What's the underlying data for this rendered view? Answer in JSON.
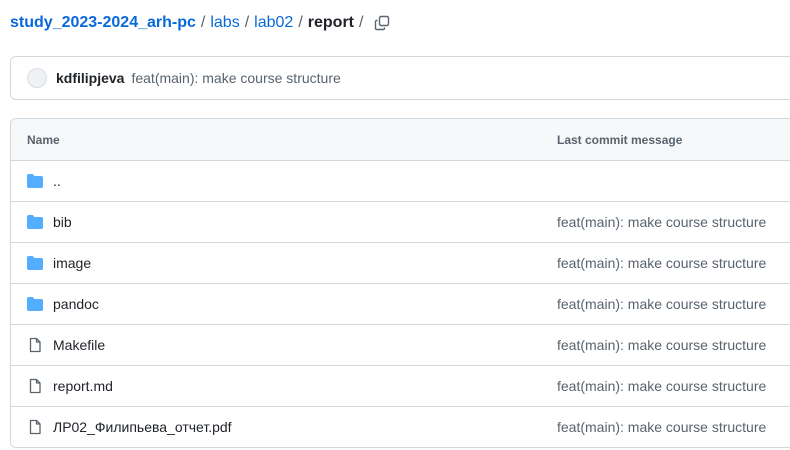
{
  "breadcrumb": {
    "repo": "study_2023-2024_arh-pc",
    "sep": "/",
    "dir1": "labs",
    "dir2": "lab02",
    "current": "report"
  },
  "commit": {
    "author": "kdfilipjeva",
    "message": "feat(main): make course structure"
  },
  "table": {
    "headers": {
      "name": "Name",
      "last_commit": "Last commit message"
    },
    "rows": [
      {
        "type": "folder",
        "name": "..",
        "message": ""
      },
      {
        "type": "folder",
        "name": "bib",
        "message": "feat(main): make course structure"
      },
      {
        "type": "folder",
        "name": "image",
        "message": "feat(main): make course structure"
      },
      {
        "type": "folder",
        "name": "pandoc",
        "message": "feat(main): make course structure"
      },
      {
        "type": "file",
        "name": "Makefile",
        "message": "feat(main): make course structure"
      },
      {
        "type": "file",
        "name": "report.md",
        "message": "feat(main): make course structure"
      },
      {
        "type": "file",
        "name": "ЛР02_Филипьева_отчет.pdf",
        "message": "feat(main): make course structure"
      }
    ]
  },
  "icons": {
    "copy": "copy-icon",
    "folder": "folder-icon",
    "file": "file-icon"
  },
  "colors": {
    "link": "#0969da",
    "folder": "#54aeff",
    "muted": "#59636e",
    "border": "#d1d9e0"
  }
}
